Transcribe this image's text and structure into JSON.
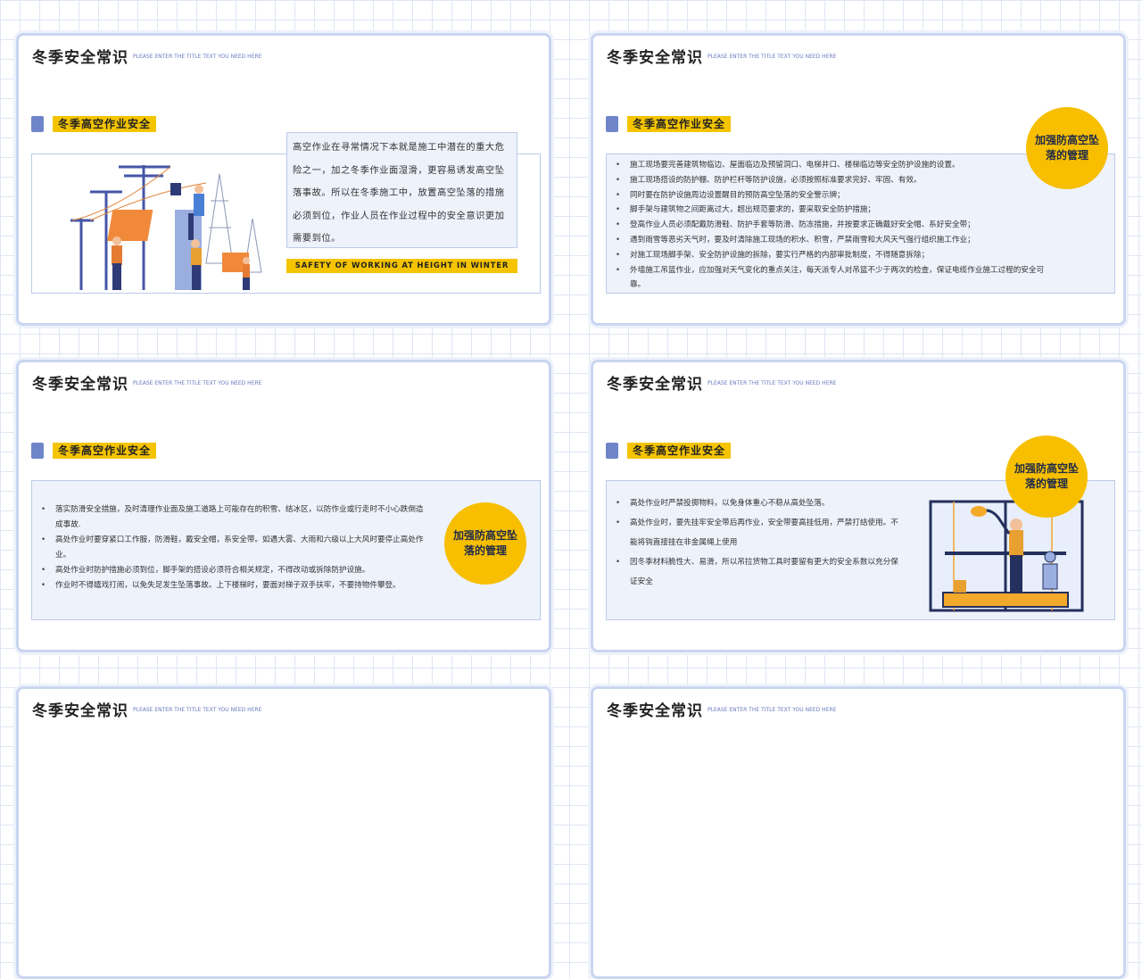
{
  "slide_title": "冬季安全常识",
  "slide_subtitle": "PLEASE ENTER THE TITLE TEXT YOU NEED HERE",
  "section_tag": "冬季高空作业安全",
  "circle_label": "加强防高空坠落的管理",
  "slide1": {
    "intro": "高空作业在寻常情况下本就是施工中潜在的重大危险之一，加之冬季作业面湿滑，更容易诱发高空坠落事故。所以在冬季施工中，放置高空坠落的措施必须到位，作业人员在作业过程中的安全意识更加需要到位。",
    "english_banner": "SAFETY OF WORKING AT HEIGHT IN WINTER"
  },
  "slide2": {
    "items": [
      "施工现场要完善建筑物临边、屋面临边及预留洞口、电梯井口、楼梯临边等安全防护设施的设置。",
      "施工现场搭设的防护棚、防护栏杆等防护设施，必须按照标准要求完好、牢固、有效。",
      "同时要在防护设施周边设置醒目的预防高空坠落的安全警示牌；",
      "脚手架与建筑物之间距离过大，超出规范要求的，要采取安全防护措施；",
      "登高作业人员必须配戴防滑鞋、防护手套等防滑、防冻措施，并按要求正确戴好安全帽、系好安全带；",
      "遇到雨雪等恶劣天气时，要及时清除施工现场的积水、积雪，严禁雨雪和大风天气强行组织施工作业；",
      "对施工现场脚手架、安全防护设施的拆除，要实行严格的内部审批制度，不得随意拆除；",
      "外墙施工吊篮作业，应加强对天气变化的重点关注，每天派专人对吊篮不少于两次的检查，保证电缆作业施工过程的安全可靠。"
    ]
  },
  "slide3": {
    "items": [
      "落实防滑安全措施，及时清理作业面及施工道路上可能存在的积雪、结冰区，以防作业或行走时不小心跌倒造成事故.",
      " 高处作业时要穿紧口工作服，防滑鞋，戴安全帽，系安全带。如遇大雾、大雨和六级以上大风时要停止高处作业。",
      "高处作业时防护措施必须到位，脚手架的搭设必须符合相关规定，不得改动或拆除防护设施。",
      "作业时不得嬉戏打闹，以免失足发生坠落事故。上下楼梯时，要面对梯子双手扶牢，不要持物件攀登。"
    ]
  },
  "slide4": {
    "items": [
      "高处作业时严禁投掷物料，以免身体重心不稳从高处坠落。",
      "高处作业时，要先挂牢安全带后再作业，安全带要高挂低用，严禁打结使用。不能将钩直接挂在非金属绳上使用",
      "因冬季材料脆性大、易滑，所以吊拉货物工具时要留有更大的安全系数以充分保证安全"
    ]
  }
}
